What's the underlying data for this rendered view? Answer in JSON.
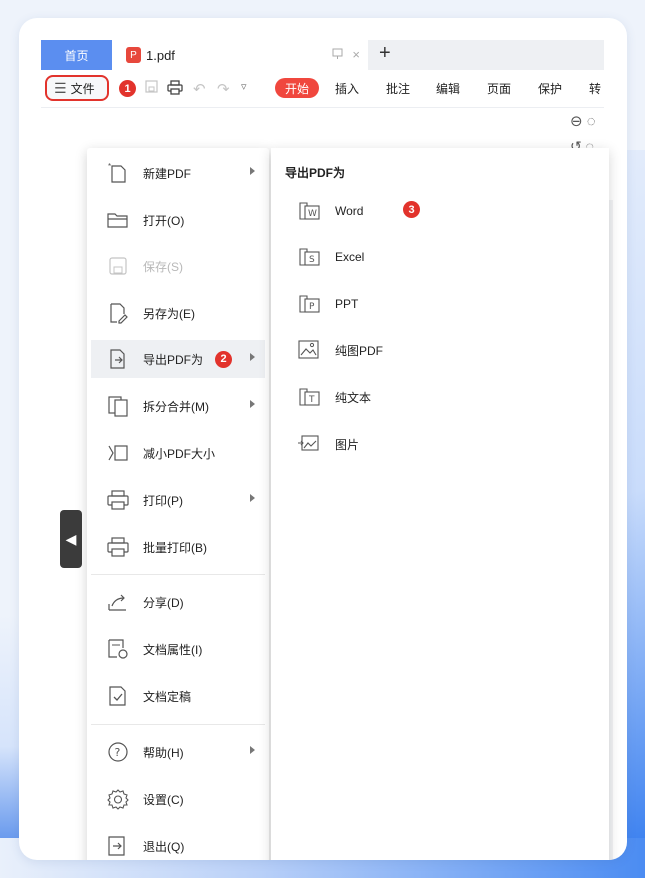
{
  "tabs": {
    "home": "首页",
    "doc": "1.pdf",
    "pdf_badge": "P",
    "pin_icon": "pin-icon",
    "close": "×",
    "add": "+"
  },
  "toolbar": {
    "file_label": "文件",
    "ribbon": [
      "开始",
      "插入",
      "批注",
      "编辑",
      "页面",
      "保护",
      "转"
    ],
    "active_ribbon_index": 0
  },
  "markers": [
    "1",
    "2",
    "3"
  ],
  "file_menu": {
    "items": [
      {
        "label": "新建PDF",
        "icon": "new-pdf-icon",
        "arrow": true
      },
      {
        "label": "打开(O)",
        "icon": "folder-open-icon",
        "arrow": false
      },
      {
        "label": "保存(S)",
        "icon": "save-icon",
        "arrow": false,
        "disabled": true
      },
      {
        "label": "另存为(E)",
        "icon": "save-as-icon",
        "arrow": false
      },
      {
        "label": "导出PDF为",
        "icon": "export-pdf-icon",
        "arrow": true,
        "active": true
      },
      {
        "label": "拆分合并(M)",
        "icon": "split-merge-icon",
        "arrow": true
      },
      {
        "label": "减小PDF大小",
        "icon": "compress-icon",
        "arrow": false
      },
      {
        "label": "打印(P)",
        "icon": "print-icon",
        "arrow": true
      },
      {
        "label": "批量打印(B)",
        "icon": "batch-print-icon",
        "arrow": false
      },
      {
        "label": "分享(D)",
        "icon": "share-icon",
        "arrow": false
      },
      {
        "label": "文档属性(I)",
        "icon": "document-properties-icon",
        "arrow": false
      },
      {
        "label": "文档定稿",
        "icon": "finalize-icon",
        "arrow": false
      },
      {
        "label": "帮助(H)",
        "icon": "help-icon",
        "arrow": true
      },
      {
        "label": "设置(C)",
        "icon": "settings-icon",
        "arrow": false
      },
      {
        "label": "退出(Q)",
        "icon": "exit-icon",
        "arrow": false
      }
    ]
  },
  "export_menu": {
    "title": "导出PDF为",
    "items": [
      {
        "label": "Word",
        "icon": "word-icon"
      },
      {
        "label": "Excel",
        "icon": "excel-icon"
      },
      {
        "label": "PPT",
        "icon": "ppt-icon"
      },
      {
        "label": "纯图PDF",
        "icon": "image-pdf-icon"
      },
      {
        "label": "纯文本",
        "icon": "text-icon"
      },
      {
        "label": "图片",
        "icon": "picture-icon"
      }
    ]
  },
  "colors": {
    "accent": "#e2332c",
    "home_tab": "#5b8ef0",
    "active_ribbon": "#f0473e"
  }
}
